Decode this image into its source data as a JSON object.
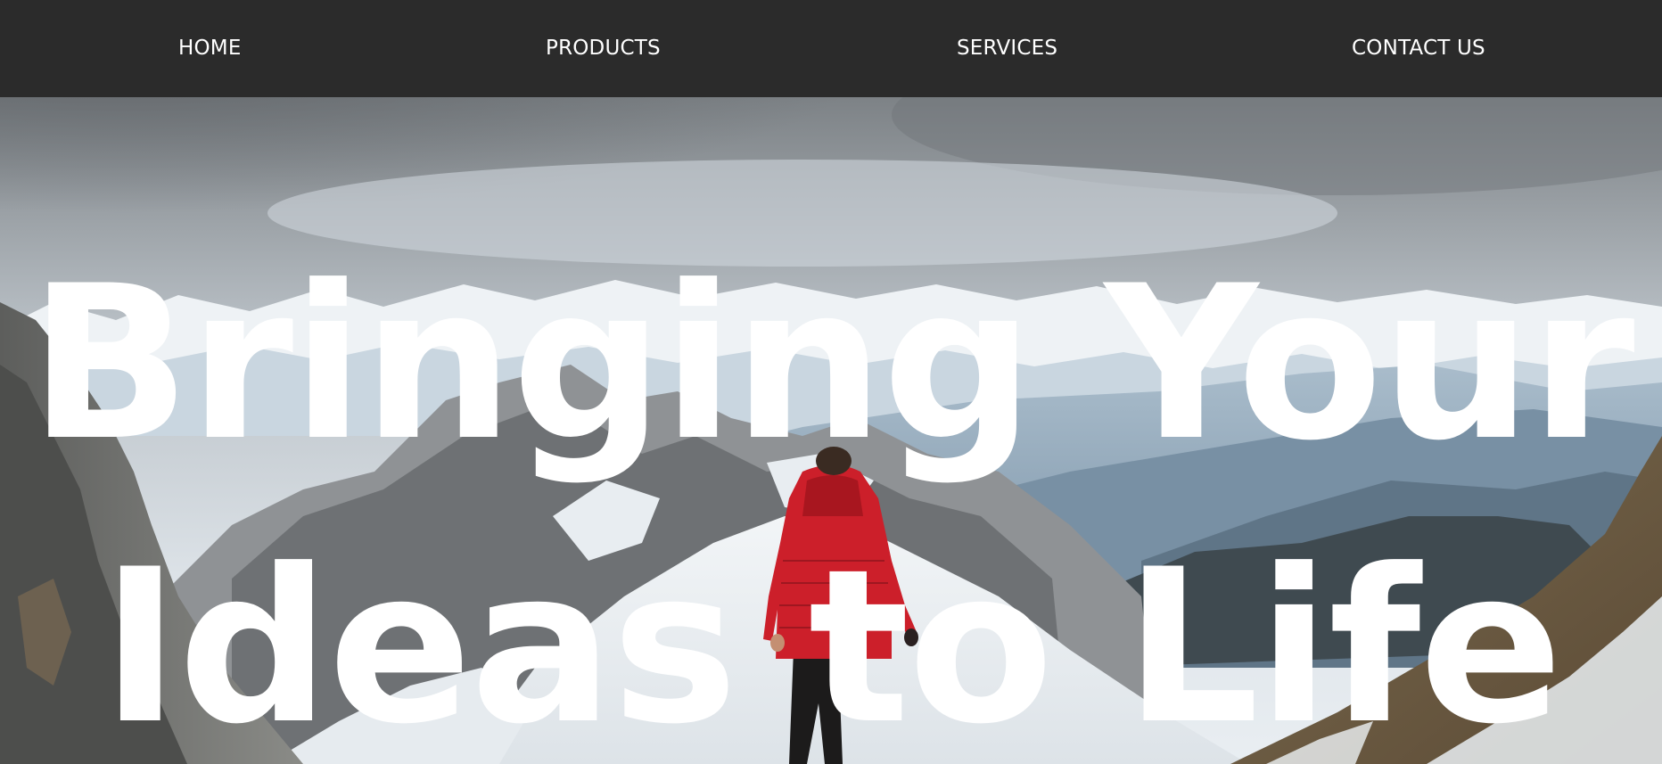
{
  "nav": {
    "items": [
      {
        "label": "HOME"
      },
      {
        "label": "PRODUCTS"
      },
      {
        "label": "SERVICES"
      },
      {
        "label": "CONTACT US"
      }
    ]
  },
  "hero": {
    "headline_line1": "Bringing Your",
    "headline_line2": "Ideas to Life"
  },
  "colors": {
    "nav_background": "#2b2b2b",
    "nav_text": "#ffffff",
    "headline_text": "#ffffff",
    "jacket_red": "#cc1f2a"
  }
}
